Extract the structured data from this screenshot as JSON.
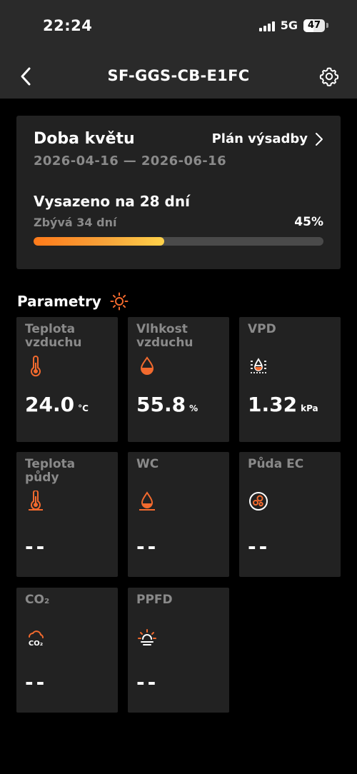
{
  "status_bar": {
    "time": "22:24",
    "network": "5G",
    "battery": "47",
    "battery_level": 0.47
  },
  "nav": {
    "title": "SF-GGS-CB-E1FC",
    "back_icon": "chevron-left-icon",
    "settings_icon": "gear-icon"
  },
  "bloom": {
    "title": "Doba květu",
    "plan_label": "Plán výsadby",
    "date_range": "2026-04-16 — 2026-06-16",
    "planted_text": "Vysazeno na 28 dní",
    "remaining_text": "Zbývá 34 dní",
    "progress_text": "45%",
    "progress_value": 0.45
  },
  "params": {
    "title": "Parametry",
    "tiles": [
      {
        "label": "Teplota vzduchu",
        "icon": "thermometer-icon",
        "value": "24.0",
        "unit": "°C"
      },
      {
        "label": "Vlhkost vzduchu",
        "icon": "humidity-drop-icon",
        "value": "55.8",
        "unit": "%"
      },
      {
        "label": "VPD",
        "icon": "vpd-icon",
        "value": "1.32",
        "unit": "kPa"
      },
      {
        "label": "Teplota půdy",
        "icon": "soil-thermometer-icon",
        "value": "--",
        "unit": ""
      },
      {
        "label": "WC",
        "icon": "water-content-icon",
        "value": "--",
        "unit": ""
      },
      {
        "label": "Půda EC",
        "icon": "soil-ec-icon",
        "value": "--",
        "unit": ""
      },
      {
        "label": "CO₂",
        "icon": "co2-cloud-icon",
        "value": "--",
        "unit": ""
      },
      {
        "label": "PPFD",
        "icon": "light-icon",
        "value": "--",
        "unit": ""
      }
    ]
  },
  "colors": {
    "accent": "#f26a2e",
    "card": "#222222",
    "muted_text": "#8a8a8a",
    "progress_start": "#ff7a1a",
    "progress_end": "#ffd24a"
  }
}
